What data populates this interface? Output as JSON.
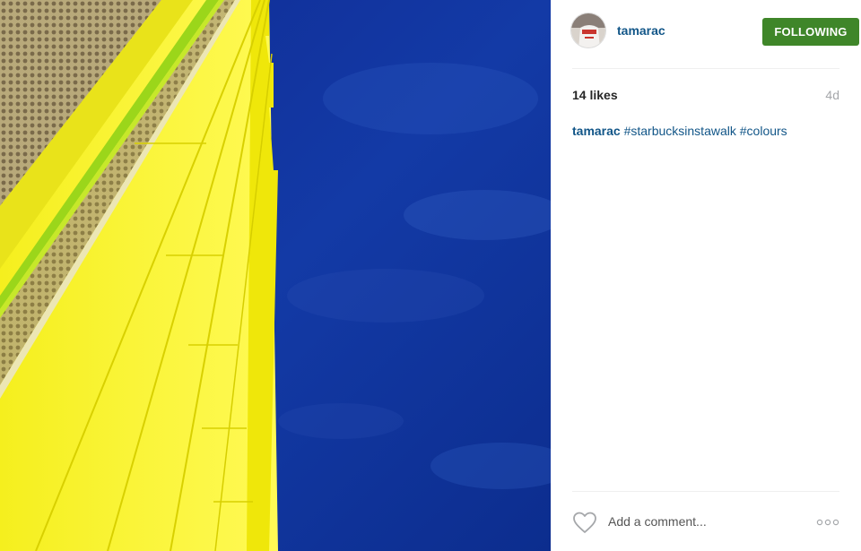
{
  "post": {
    "username": "tamarac",
    "follow_button_label": "FOLLOWING",
    "likes": "14 likes",
    "age": "4d",
    "caption": {
      "username": "tamarac",
      "hashtags": [
        "#starbucksinstawalk",
        "#colours"
      ]
    },
    "comment": {
      "placeholder": "Add a comment...",
      "value": ""
    },
    "icons": {
      "like": "heart-outline-icon",
      "more": "more-options-icon"
    }
  },
  "colors": {
    "link": "#125688",
    "follow_button_bg": "#3f8629",
    "photo_sky": "#10309a",
    "photo_building": "#f2eb0d"
  }
}
